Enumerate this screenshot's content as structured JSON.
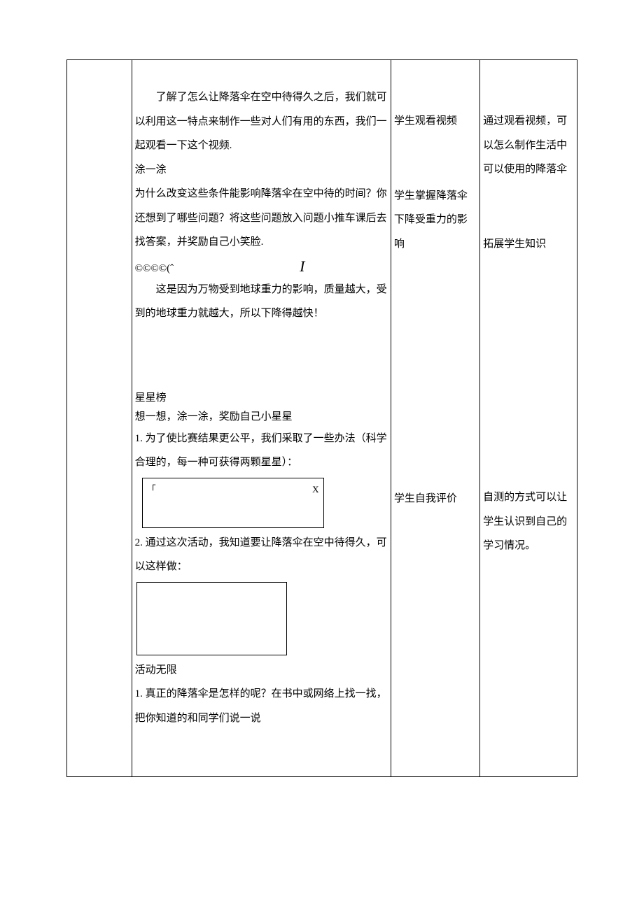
{
  "col2": {
    "p1": "了解了怎么让降落伞在空中待得久之后，我们就可以利用这一特点来制作一些对人们有用的东西，我们一起观看一下这个视频.",
    "p2_title": "涂一涂",
    "p2_body": "为什么改变这些条件能影响降落伞在空中待的时间？你还想到了哪些问题？将这些问题放入问题小推车课后去找答案，并奖励自己小笑脸.",
    "symbols_left": "©©©©(ˆ",
    "symbols_right": "I",
    "p3": "这是因为万物受到地球重力的影响，质量越大，受到的地球重力就越大，所以下降得越快！",
    "stars_title": "星星榜",
    "stars_sub": "想一想，涂一涂，奖励自己小星星",
    "stars_q1": "1. 为了使比赛结果更公平，我们采取了一些办法（科学合理的，每一种可获得两颗星星）：",
    "box1_left": "「",
    "box1_right": "X",
    "stars_q2": "2. 通过这次活动，我知道要让降落伞在空中待得久，可以这样做：",
    "activity_title": "活动无限",
    "activity_q1": "1. 真正的降落伞是怎样的呢？在书中或网络上找一找，把你知道的和同学们说一说"
  },
  "col3": {
    "b1": "学生观看视频",
    "b2": "学生掌握降落伞下降受重力的影响",
    "b3": "学生自我评价"
  },
  "col4": {
    "b1": "通过观看视频，可以怎么制作生活中可以使用的降落伞",
    "b2": "拓展学生知识",
    "b3": "自测的方式可以让学生认识到自己的学习情况。"
  }
}
